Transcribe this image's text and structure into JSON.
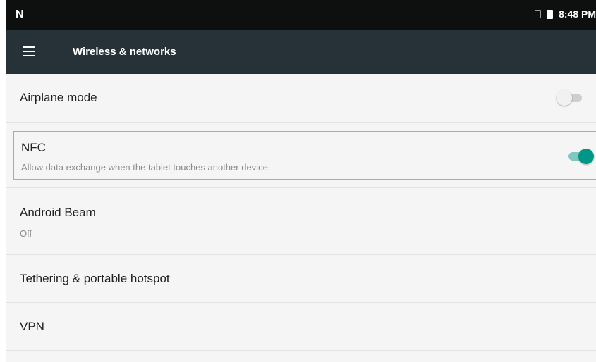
{
  "status_bar": {
    "left_icon_glyph": "N",
    "time": "8:48 PM",
    "icons": [
      "notification-n-icon",
      "no-sim-icon",
      "battery-icon"
    ]
  },
  "toolbar": {
    "title": "Wireless & networks",
    "menu_icon": "menu-icon"
  },
  "settings": {
    "airplane": {
      "title": "Airplane mode",
      "enabled": false
    },
    "nfc": {
      "title": "NFC",
      "summary": "Allow data exchange when the tablet touches another device",
      "enabled": true
    },
    "beam": {
      "title": "Android Beam",
      "summary": "Off"
    },
    "tethering": {
      "title": "Tethering & portable hotspot"
    },
    "vpn": {
      "title": "VPN"
    }
  },
  "colors": {
    "status_bar": "#0e1010",
    "toolbar": "#263238",
    "accent": "#009688",
    "highlight_border": "#f28b8b",
    "background": "#f5f5f5"
  }
}
